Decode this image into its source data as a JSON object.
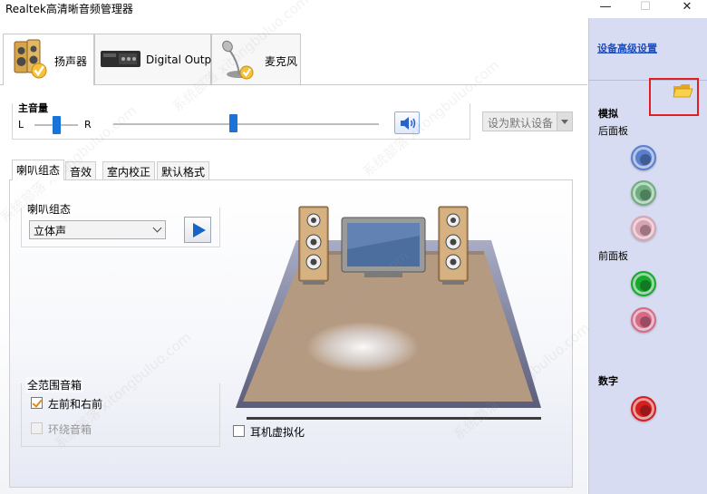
{
  "window": {
    "title": "Realtek高清晰音频管理器",
    "minimize_glyph": "—",
    "maximize_glyph": "☐",
    "close_glyph": "✕"
  },
  "device_tabs": [
    {
      "label": "扬声器",
      "icon": "speaker-icon",
      "active": true
    },
    {
      "label": "Digital Output",
      "icon": "digital-output-icon",
      "active": false
    },
    {
      "label": "麦克风",
      "icon": "microphone-icon",
      "active": false
    }
  ],
  "volume": {
    "title": "主音量",
    "left_label": "L",
    "right_label": "R",
    "balance": 0.5,
    "level": 0.45
  },
  "default_device_button": "设为默认设备",
  "inner_tabs": [
    "喇叭组态",
    "音效",
    "室内校正",
    "默认格式"
  ],
  "speaker_config": {
    "group_title": "喇叭组态",
    "selected": "立体声"
  },
  "full_range": {
    "title": "全范围音箱",
    "options": [
      {
        "label": "左前和右前",
        "checked": true,
        "enabled": true
      },
      {
        "label": "环绕音箱",
        "checked": false,
        "enabled": false
      }
    ]
  },
  "headphone_virtualization": {
    "label": "耳机虚拟化",
    "checked": false
  },
  "right_panel": {
    "advanced_link": "设备高级设置",
    "analog_title": "模拟",
    "back_panel": "后面板",
    "front_panel": "前面板",
    "digital_title": "数字",
    "jacks_back": [
      {
        "color": "#5a7fcf",
        "name": "blue"
      },
      {
        "color": "#6fae7f",
        "name": "green"
      },
      {
        "color": "#d9a3b3",
        "name": "pink"
      }
    ],
    "jacks_front": [
      {
        "color": "#17a82e",
        "name": "green"
      },
      {
        "color": "#d66a88",
        "name": "pink"
      }
    ],
    "jack_digital": {
      "color": "#d42020",
      "name": "red"
    }
  },
  "watermark": "系统部落 xitongbuluo.com"
}
